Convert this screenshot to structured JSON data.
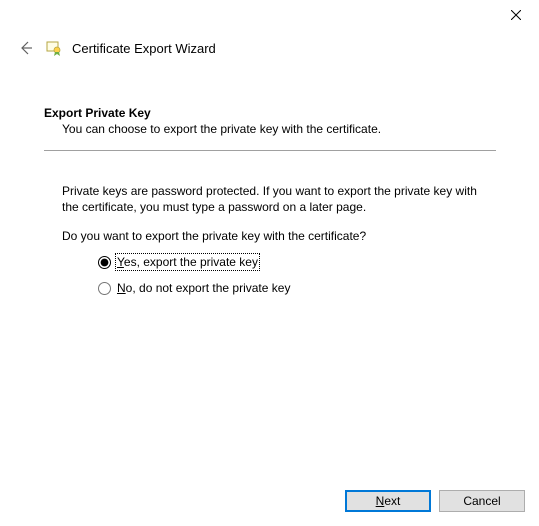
{
  "window": {
    "title": "Certificate Export Wizard"
  },
  "page": {
    "heading": "Export Private Key",
    "subheading": "You can choose to export the private key with the certificate.",
    "body": "Private keys are password protected. If you want to export the private key with the certificate, you must type a password on a later page.",
    "question": "Do you want to export the private key with the certificate?"
  },
  "options": {
    "yes_prefix": "Y",
    "yes_rest": "es, export the private key",
    "no_prefix": "N",
    "no_rest": "o, do not export the private key",
    "selected": "yes"
  },
  "footer": {
    "next_prefix": "N",
    "next_rest": "ext",
    "cancel": "Cancel"
  }
}
